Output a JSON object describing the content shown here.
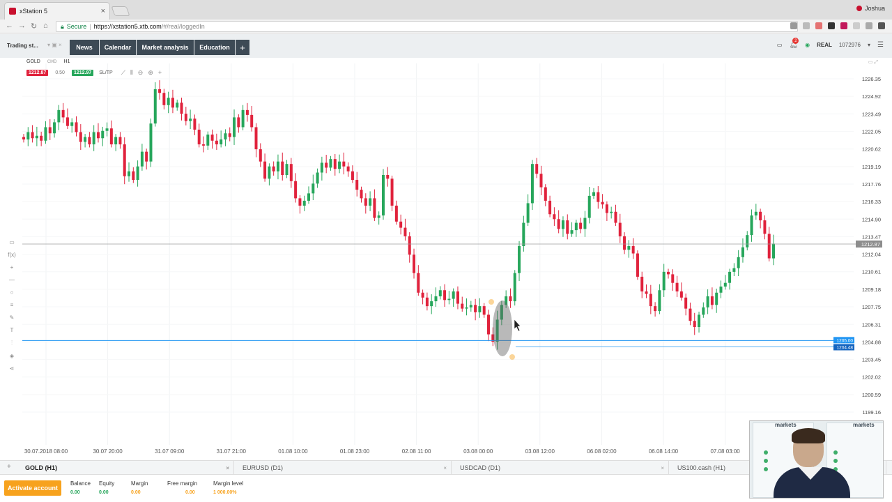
{
  "browser": {
    "tab_title": "xStation 5",
    "tab_close": "×",
    "profile_name": "Joshua",
    "secure_label": "Secure",
    "url_main": "https://xstation5.xtb.com",
    "url_rest": "/#/real/loggedIn",
    "brand_color": "#c8102e"
  },
  "toolbar": {
    "workspace": "Trading st...",
    "tabs": [
      "News",
      "Calendar",
      "Market analysis",
      "Education"
    ],
    "plus": "+",
    "notifications_count": "2",
    "account_type": "REAL",
    "account_number": "1072976"
  },
  "chart": {
    "symbol": "GOLD",
    "instrument_type": "CMD",
    "timeframe": "H1",
    "sell_price": "1212.87",
    "volume": "0.50",
    "buy_price": "1212.97",
    "sltp_label": "SL/TP",
    "current_price_tag": "1212.87",
    "order_tag_upper": "1205.00",
    "order_tag_lower": "1204.48"
  },
  "chart_data": {
    "type": "candlestick",
    "symbol": "GOLD",
    "timeframe": "H1",
    "x_tick_labels": [
      "30.07.2018 08:00",
      "30.07 20:00",
      "31.07 09:00",
      "31.07 21:00",
      "01.08 10:00",
      "01.08 23:00",
      "02.08 11:00",
      "03.08 00:00",
      "03.08 12:00",
      "06.08 02:00",
      "06.08 14:00",
      "07.08 03:00"
    ],
    "y_tick_labels": [
      "1226.35",
      "1224.92",
      "1223.49",
      "1222.05",
      "1220.62",
      "1219.19",
      "1217.76",
      "1216.33",
      "1214.90",
      "1213.47",
      "1212.04",
      "1210.61",
      "1209.18",
      "1207.75",
      "1206.31",
      "1204.88",
      "1203.45",
      "1202.02",
      "1200.59",
      "1199.16"
    ],
    "ylim": [
      1199.16,
      1226.35
    ],
    "current_price": 1212.87,
    "horizontal_lines": [
      1212.87,
      1205.0,
      1204.48
    ],
    "close_prices": [
      1221.4,
      1222.0,
      1221.5,
      1221.7,
      1221.3,
      1222.4,
      1221.9,
      1222.8,
      1223.8,
      1223.2,
      1222.5,
      1222.8,
      1222.0,
      1221.2,
      1221.6,
      1221.0,
      1222.0,
      1221.5,
      1222.1,
      1222.3,
      1221.0,
      1221.6,
      1221.0,
      1218.4,
      1218.8,
      1218.1,
      1219.2,
      1220.4,
      1219.6,
      1222.7,
      1225.5,
      1225.2,
      1224.2,
      1224.8,
      1224.0,
      1224.4,
      1223.5,
      1222.9,
      1223.1,
      1222.2,
      1221.0,
      1220.9,
      1221.8,
      1221.3,
      1221.0,
      1221.4,
      1221.9,
      1221.6,
      1223.2,
      1222.4,
      1223.8,
      1223.4,
      1222.4,
      1220.6,
      1219.6,
      1218.2,
      1219.2,
      1218.8,
      1219.6,
      1218.5,
      1219.4,
      1218.0,
      1216.6,
      1216.0,
      1216.4,
      1217.0,
      1217.8,
      1218.7,
      1219.5,
      1219.1,
      1219.8,
      1219.0,
      1219.6,
      1219.2,
      1218.8,
      1218.1,
      1217.3,
      1216.6,
      1216.0,
      1216.6,
      1215.0,
      1215.2,
      1218.5,
      1218.2,
      1216.0,
      1214.7,
      1214.2,
      1213.5,
      1212.0,
      1210.5,
      1208.9,
      1208.5,
      1207.8,
      1208.2,
      1208.6,
      1209.1,
      1208.3,
      1208.4,
      1209.0,
      1208.0,
      1207.6,
      1207.7,
      1207.9,
      1207.3,
      1207.8,
      1207.1,
      1205.5,
      1204.9,
      1206.7,
      1207.9,
      1208.6,
      1208.2,
      1210.5,
      1212.7,
      1214.6,
      1216.2,
      1219.4,
      1218.6,
      1217.5,
      1216.4,
      1215.3,
      1214.9,
      1214.1,
      1214.8,
      1213.7,
      1214.0,
      1214.6,
      1214.1,
      1215.0,
      1216.8,
      1217.1,
      1216.3,
      1216.1,
      1215.4,
      1215.5,
      1214.6,
      1213.5,
      1212.4,
      1212.7,
      1212.1,
      1210.2,
      1209.0,
      1208.8,
      1207.8,
      1207.4,
      1209.1,
      1210.6,
      1210.4,
      1209.7,
      1209.0,
      1208.5,
      1207.6,
      1206.6,
      1206.1,
      1207.1,
      1207.7,
      1208.6,
      1207.9,
      1208.9,
      1209.4,
      1209.7,
      1210.6,
      1210.9,
      1211.8,
      1212.6,
      1213.6,
      1215.2,
      1215.5,
      1214.8,
      1213.7,
      1211.7,
      1212.9
    ]
  },
  "instrument_tabs": [
    "GOLD (H1)",
    "EURUSD (D1)",
    "USDCAD (D1)",
    "US100.cash (H1)"
  ],
  "account": {
    "activate_label": "Activate account",
    "metrics": [
      {
        "label": "Balance",
        "value": "0.00"
      },
      {
        "label": "Equity",
        "value": "0.00"
      },
      {
        "label": "Margin",
        "value": "0.00"
      },
      {
        "label": "Free margin",
        "value": "0.00"
      },
      {
        "label": "Margin level",
        "value": "1 000.00%"
      }
    ]
  },
  "webcam": {
    "header_left": "markets",
    "header_right": "markets"
  },
  "colors": {
    "bull": "#26a65b",
    "bear": "#e0223c",
    "tab_dark": "#3d4a55",
    "activate": "#f7a21d",
    "order_line": "#2196f3"
  },
  "icons": [
    "back-arrow-icon",
    "forward-arrow-icon",
    "reload-icon",
    "home-icon",
    "lock-icon",
    "key-icon",
    "star-icon",
    "bell-icon",
    "wifi-icon",
    "menu-icon",
    "crosshair-icon",
    "zoom-in-icon",
    "zoom-out-icon",
    "line-chart-icon",
    "candles-icon",
    "pen-icon",
    "text-icon",
    "share-icon",
    "cursor-icon"
  ]
}
